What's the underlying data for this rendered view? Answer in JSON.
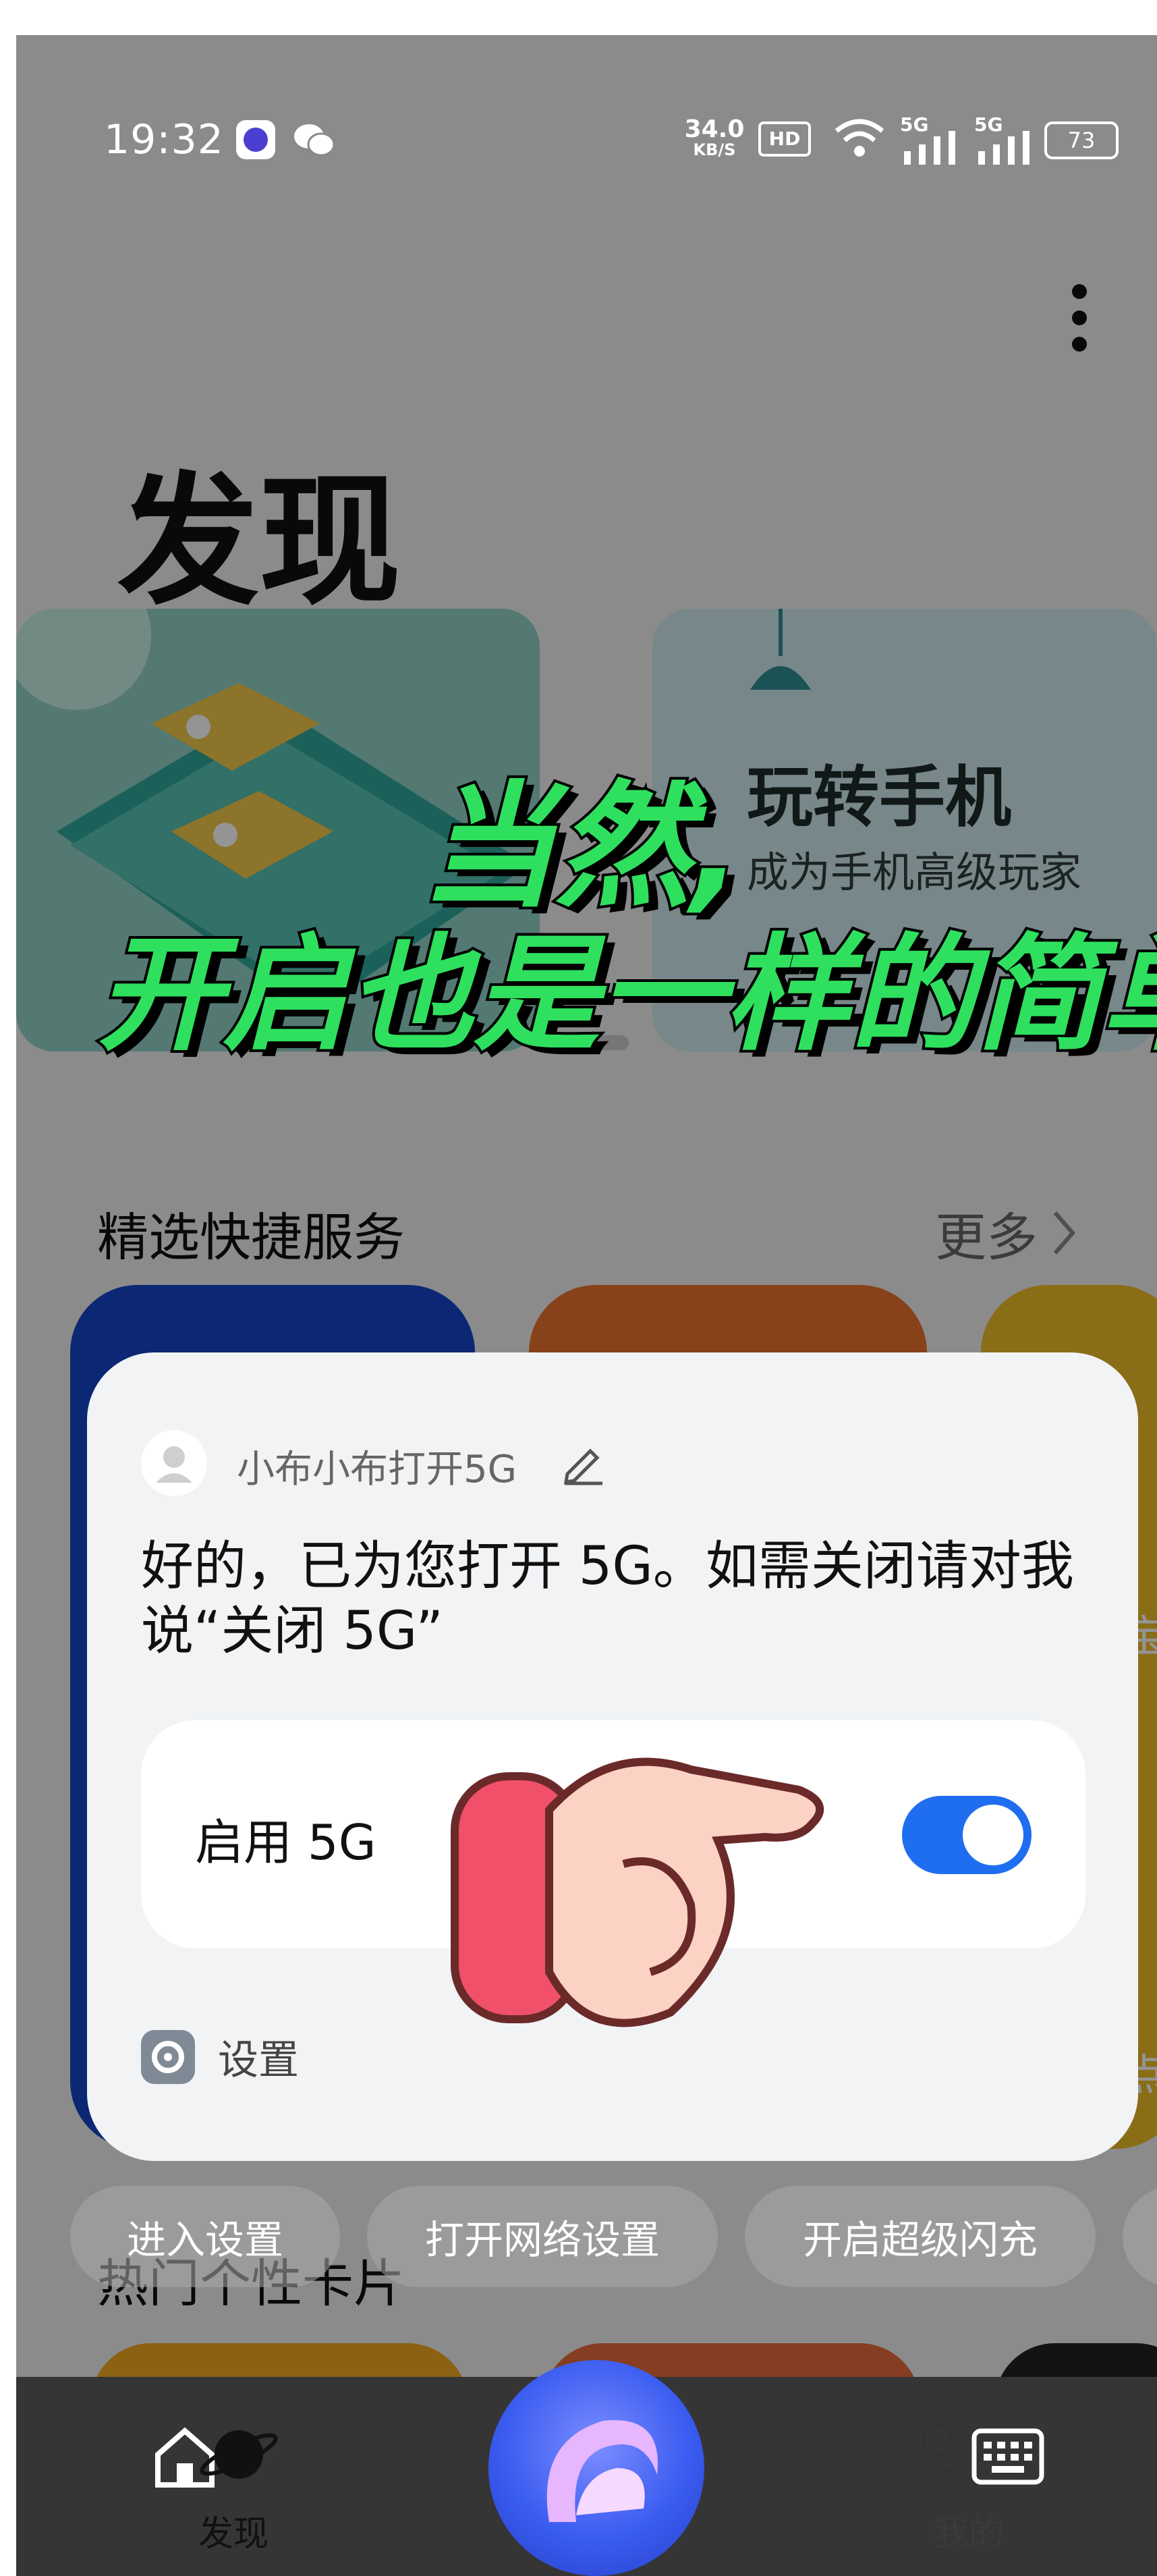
{
  "status_bar": {
    "time": "19:32",
    "speed_value": "34.0",
    "speed_unit": "KB/S",
    "hd_label": "HD",
    "signal_1": "5G",
    "signal_2": "5G",
    "battery": "73",
    "icons": [
      "app-notification-icon",
      "wechat-icon",
      "wifi-icon",
      "signal-icon",
      "battery-icon"
    ]
  },
  "page": {
    "title": "发现",
    "more_menu_icon": "vertical-dots-icon"
  },
  "banner": {
    "card2_title": "玩转手机",
    "card2_subtitle": "成为手机高级玩家"
  },
  "caption": {
    "line1": "当然,",
    "line2": "开启也是一样的简单"
  },
  "quick_services": {
    "title": "精选快捷服务",
    "more": "更多",
    "partial_text_1": "宝",
    "partial_text_2": "点"
  },
  "hot_cards": {
    "title": "热门个性卡片"
  },
  "dialog": {
    "query": "小布小布打开5G",
    "response": "好的，已为您打开 5G。如需关闭请对我说“关闭 5G”",
    "toggle_label": "启用 5G",
    "toggle_on": true,
    "settings_label": "设置"
  },
  "chips": [
    "进入设置",
    "打开网络设置",
    "开启超级闪充"
  ],
  "bottom_nav": {
    "discover": "发现",
    "mine": "我的"
  },
  "colors": {
    "toggle_on": "#1f6ef0",
    "caption_fill": "#2fe05f",
    "assistant_orb": "#3a5cf0"
  }
}
